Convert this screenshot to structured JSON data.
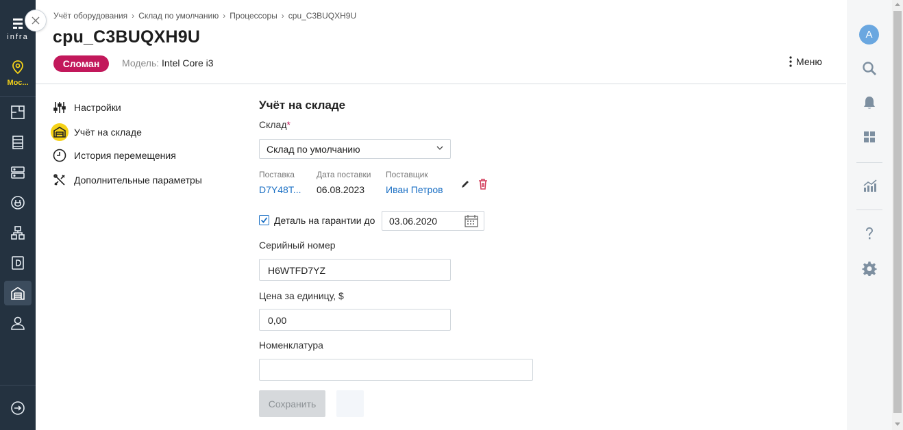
{
  "app": {
    "logo_text": "infra",
    "location_short": "Мос..."
  },
  "breadcrumb": {
    "items": [
      "Учёт оборудования",
      "Склад по умолчанию",
      "Процессоры",
      "cpu_C3BUQXH9U"
    ],
    "separator": "›"
  },
  "header": {
    "title": "cpu_C3BUQXH9U",
    "status": "Сломан",
    "status_color": "#c2185b",
    "model_label": "Модель:",
    "model_value": "Intel Core i3",
    "menu_label": "Меню",
    "close_icon": "close-icon"
  },
  "section_nav": [
    {
      "label": "Настройки",
      "icon": "sliders-icon",
      "active": false
    },
    {
      "label": "Учёт на складе",
      "icon": "warehouse-icon",
      "active": true
    },
    {
      "label": "История перемещения",
      "icon": "clock-icon",
      "active": false
    },
    {
      "label": "Дополнительные параметры",
      "icon": "tools-icon",
      "active": false
    }
  ],
  "form": {
    "title": "Учёт на складе",
    "warehouse_label": "Склад",
    "warehouse_required_mark": "*",
    "warehouse_value": "Склад по умолчанию",
    "supply": {
      "supply_label": "Поставка",
      "supply_value": "D7Y48T...",
      "date_label": "Дата поставки",
      "date_value": "06.08.2023",
      "supplier_label": "Поставщик",
      "supplier_value": "Иван Петров"
    },
    "warranty_checked": true,
    "warranty_label": "Деталь на гарантии до",
    "warranty_date": "03.06.2020",
    "serial_label": "Серийный номер",
    "serial_value": "H6WTFD7YZ",
    "price_label": "Цена за единицу, $",
    "price_value": "0,00",
    "nomenclature_label": "Номенклатура",
    "nomenclature_value": "",
    "save_label": "Сохранить"
  },
  "right_bar": {
    "avatar_letter": "A"
  },
  "colors": {
    "accent": "#1a6fc4",
    "highlight": "#f5d218",
    "sidebar": "#243240"
  }
}
